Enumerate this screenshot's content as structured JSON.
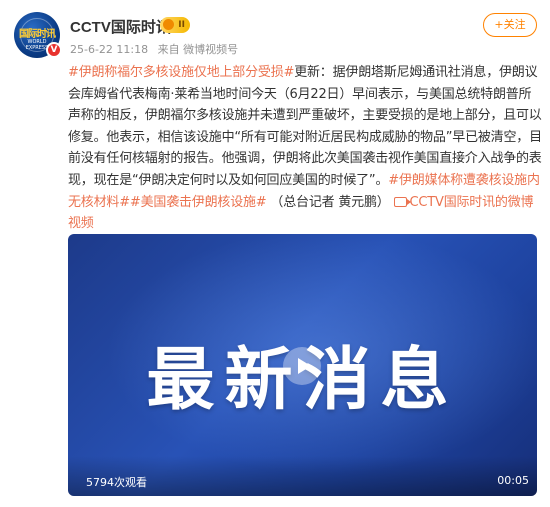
{
  "post": {
    "username": "CCTV国际时讯",
    "vip_level": "II",
    "timestamp": "25-6-22 11:18",
    "source": "来自 微博视频号",
    "follow_label": "+关注",
    "avatar_text_cn": "国际时讯",
    "avatar_text_en": "WORLD EXPRESS",
    "verified_mark": "V"
  },
  "content": {
    "tag_1": "#伊朗称福尔多核设施仅地上部分受损#",
    "text_1": "更新：据伊朗塔斯尼姆通讯社消息，伊朗议会库姆省代表梅南·莱希当地时间今天（6月22日）早间表示，与美国总统特朗普所声称的相反，伊朗福尔多核设施并未遭到严重破坏，主要受损的是地上部分，且可以修复。他表示，相信该设施中“所有可能对附近居民构成威胁的物品”早已被清空，目前没有任何核辐射的报告。他强调，伊朗将此次美国袭击视作美国直接介入战争的表现，现在是“伊朗决定何时以及如何回应美国的时候了”。",
    "tag_2": "#伊朗媒体称遭袭核设施内无核材料#",
    "tag_3": "#美国袭击伊朗核设施#",
    "text_2": " （总台记者 黄元鹏）",
    "video_link": "CCTV国际时讯的微博视频"
  },
  "video": {
    "headline": "最新消息",
    "views": "5794次观看",
    "duration": "00:05"
  },
  "colors": {
    "accent": "#eb7350",
    "follow": "#ff8200",
    "video_bg": "#2852b6"
  }
}
